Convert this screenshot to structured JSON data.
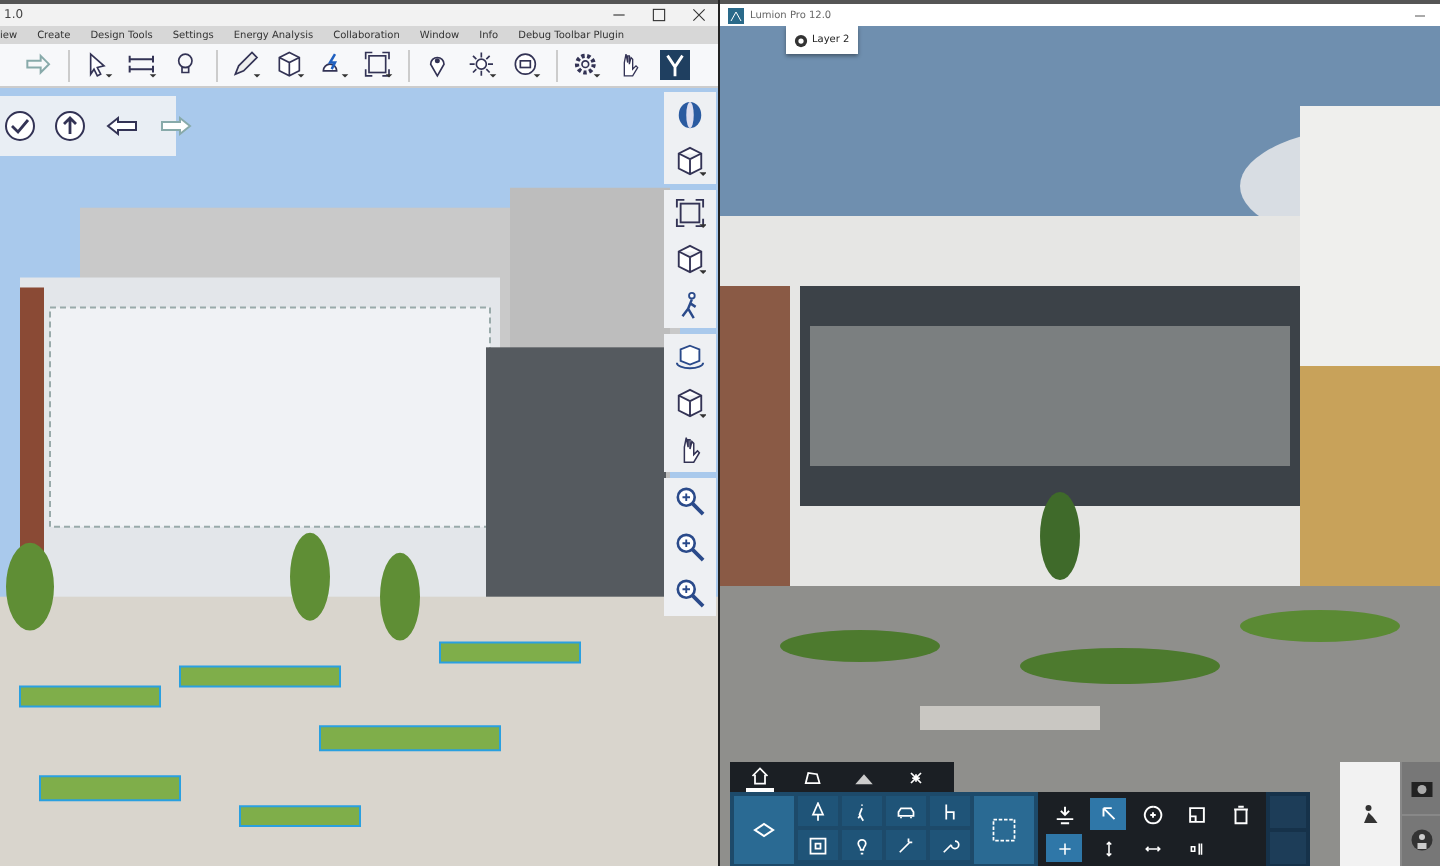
{
  "left_window": {
    "title": "1.0",
    "menu": [
      "iew",
      "Create",
      "Design Tools",
      "Settings",
      "Energy Analysis",
      "Collaboration",
      "Window",
      "Info",
      "Debug Toolbar Plugin"
    ]
  },
  "right_window": {
    "title": "Lumion Pro 12.0",
    "layer_chip": {
      "label": "Layer 2"
    },
    "bottom_tabs": [
      {
        "selected": true
      },
      {
        "selected": false
      },
      {
        "selected": false
      },
      {
        "selected": false
      }
    ],
    "object_tools": [
      {
        "selected": false
      },
      {
        "selected": true
      },
      {
        "selected": false
      },
      {
        "selected": false
      },
      {
        "selected": false
      }
    ],
    "transform_tools": [
      {
        "selected": true
      },
      {
        "selected": false
      },
      {
        "selected": false
      },
      {
        "selected": false
      }
    ],
    "mode_buttons": [
      {
        "selected": true
      },
      {
        "selected": false
      },
      {
        "selected": false
      }
    ]
  }
}
